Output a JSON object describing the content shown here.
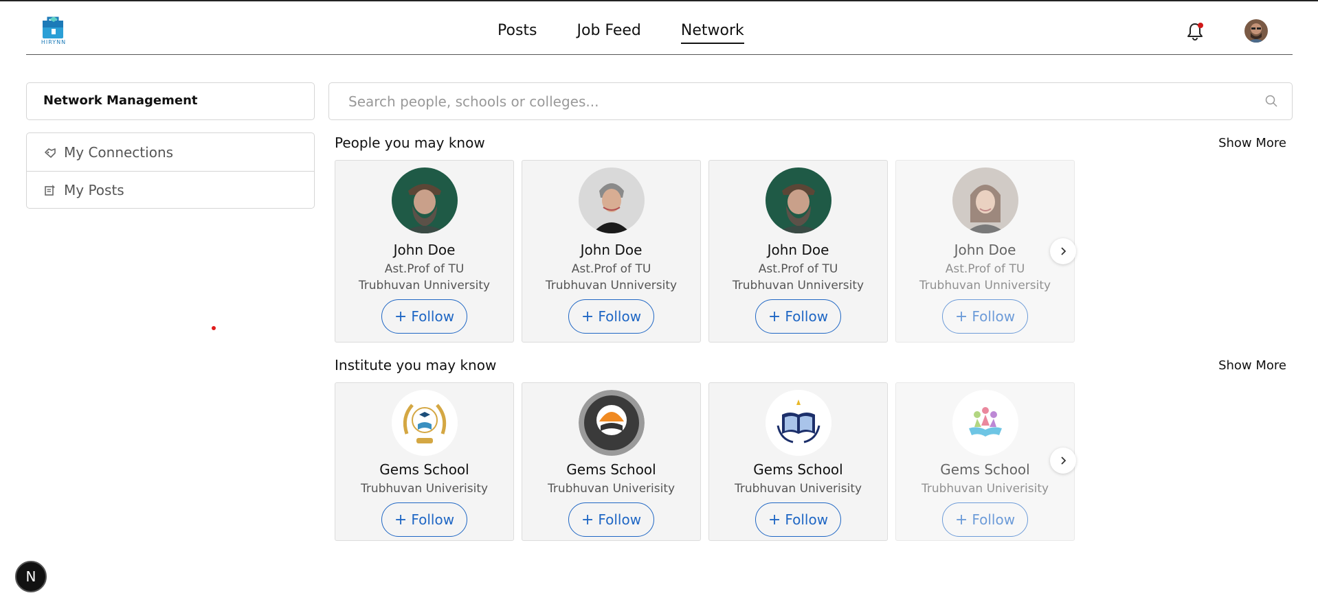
{
  "header": {
    "logo_text": "HIRYNN",
    "nav": [
      {
        "label": "Posts"
      },
      {
        "label": "Job Feed"
      },
      {
        "label": "Network",
        "active": true
      }
    ],
    "notification_icon": "bell-icon",
    "notification_dot_color": "#d01818"
  },
  "sidebar": {
    "title": "Network Management",
    "items": [
      {
        "label": "My Connections",
        "icon": "handshake-icon"
      },
      {
        "label": "My Posts",
        "icon": "post-edit-icon"
      }
    ]
  },
  "search": {
    "placeholder": "Search people, schools or colleges..."
  },
  "people_section": {
    "title": "People you may know",
    "show_more": "Show More",
    "cards": [
      {
        "name": "John Doe",
        "role": "Ast.Prof of TU",
        "org": "Trubhuvan Unniversity",
        "follow": "Follow"
      },
      {
        "name": "John Doe",
        "role": "Ast.Prof of TU",
        "org": "Trubhuvan Unniversity",
        "follow": "Follow"
      },
      {
        "name": "John Doe",
        "role": "Ast.Prof of TU",
        "org": "Trubhuvan Unniversity",
        "follow": "Follow"
      },
      {
        "name": "John Doe",
        "role": "Ast.Prof of TU",
        "org": "Trubhuvan Unniversity",
        "follow": "Follow"
      }
    ]
  },
  "institute_section": {
    "title": "Institute you may know",
    "show_more": "Show More",
    "cards": [
      {
        "name": "Gems School",
        "org": "Trubhuvan Univerisity",
        "follow": "Follow"
      },
      {
        "name": "Gems School",
        "org": "Trubhuvan Univerisity",
        "follow": "Follow"
      },
      {
        "name": "Gems School",
        "org": "Trubhuvan Univerisity",
        "follow": "Follow"
      },
      {
        "name": "Gems School",
        "org": "Trubhuvan Univerisity",
        "follow": "Follow"
      }
    ]
  },
  "colors": {
    "accent": "#1e66c4",
    "card_bg": "#f4f4f4"
  },
  "floating_badge": "N"
}
